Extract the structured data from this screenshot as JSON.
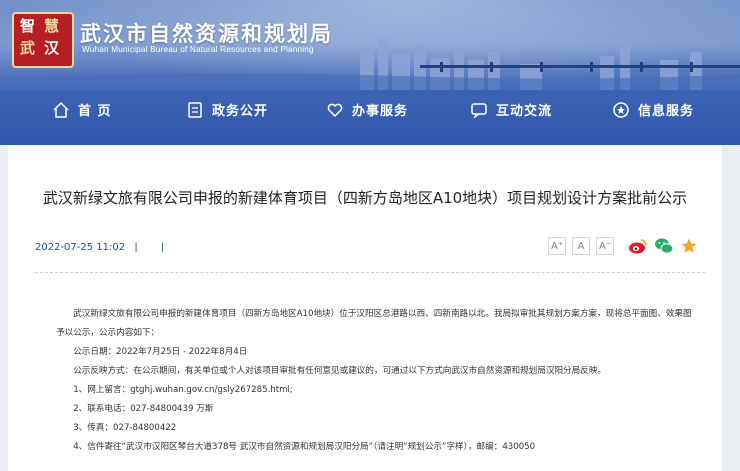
{
  "header": {
    "logo_chars": [
      "智",
      "慧",
      "武",
      "汉"
    ],
    "site_title": "武汉市自然资源和规划局",
    "site_subtitle": "Wuhan Municipal Bureau of Natural Resources and Planning"
  },
  "nav": {
    "items": [
      {
        "label": "首 页",
        "icon": "home-icon"
      },
      {
        "label": "政务公开",
        "icon": "document-icon"
      },
      {
        "label": "办事服务",
        "icon": "heart-icon"
      },
      {
        "label": "互动交流",
        "icon": "chat-icon"
      },
      {
        "label": "信息服务",
        "icon": "star-circle-icon"
      }
    ]
  },
  "article": {
    "title": "武汉新绿文旅有限公司申报的新建体育项目（四新方岛地区A10地块）项目规划设计方案批前公示",
    "date": "2022-07-25 11:02",
    "sep1": "|",
    "sep2": "|",
    "font_buttons": [
      "A⁺",
      "A",
      "A⁻"
    ],
    "share_icons": [
      "weibo-icon",
      "wechat-icon",
      "favorite-star-icon"
    ],
    "paragraphs": [
      "武汉新绿文旅有限公司申报的新建体育项目（四新方岛地区A10地块）位于汉阳区总港路以西、四新南路以北。我局拟审批其规划方案方案，现将总平面图、效果图予以公示，公示内容如下：",
      "公示日期：2022年7月25日 - 2022年8月4日",
      "公示反映方式：在公示期间，有关单位或个人对该项目审批有任何意见或建议的，可通过以下方式向武汉市自然资源和规划局汉阳分局反映。",
      "1、网上留言：gtghj.wuhan.gov.cn/gsly267285.html;",
      "2、联系电话：027-84800439 万斯",
      "3、传真：027-84800422",
      "4、信件寄往“武汉市汉阳区琴台大道378号  武汉市自然资源和规划局汉阳分局”（请注明“规划公示”字样），邮编：430050"
    ]
  },
  "colors": {
    "accent": "#1e4ea0",
    "banner_blue": "#2f57ad",
    "logo_red": "#b51e23",
    "weibo": "#e6162d",
    "wechat": "#2aae67",
    "star": "#f5a623"
  }
}
